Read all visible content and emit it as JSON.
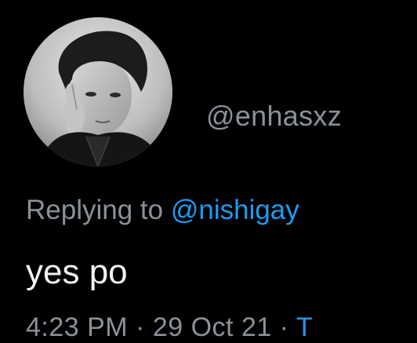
{
  "tweet": {
    "handle": "@enhasxz",
    "reply_prefix": "Replying to ",
    "reply_mention": "@nishigay",
    "text": "yes po",
    "timestamp_partial": "4:23 PM · 29 Oct 21 · ",
    "timestamp_accent_partial": "T"
  },
  "avatar": {
    "icon": "profile-photo-avatar"
  },
  "colors": {
    "background": "#000000",
    "muted_text": "#8b9198",
    "mention_blue": "#1d9bf0",
    "body_text": "#f2f2f2"
  }
}
